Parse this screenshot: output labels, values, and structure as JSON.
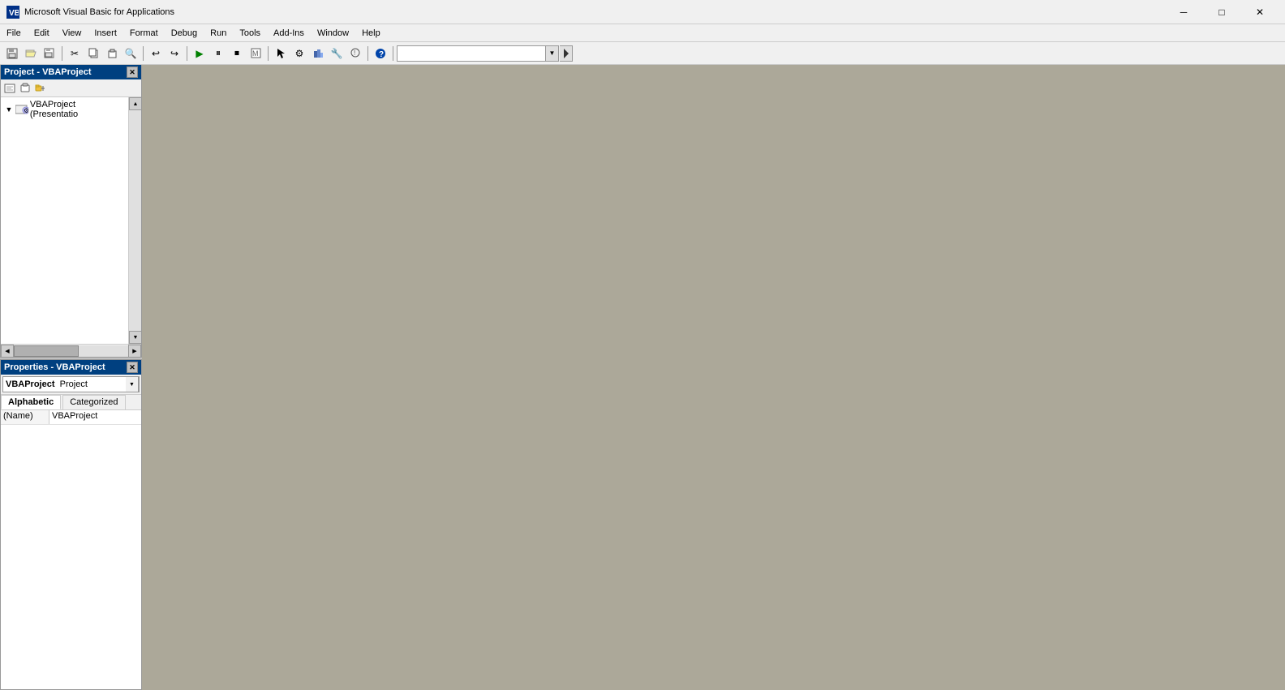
{
  "window": {
    "title": "Microsoft Visual Basic for Applications",
    "icon_label": "VB"
  },
  "title_controls": {
    "minimize": "─",
    "maximize": "□",
    "close": "✕"
  },
  "menu": {
    "items": [
      "File",
      "Edit",
      "View",
      "Insert",
      "Format",
      "Debug",
      "Run",
      "Tools",
      "Add-Ins",
      "Window",
      "Help"
    ]
  },
  "toolbar": {
    "buttons": [
      "💾",
      "📂",
      "💿",
      "✂",
      "📋",
      "📄",
      "↩",
      "↪",
      "▶",
      "⏸",
      "⏹",
      "🔲",
      "🖊",
      "⚙",
      "📊",
      "🔧",
      "❓"
    ]
  },
  "project_panel": {
    "title": "Project - VBAProject",
    "buttons": [
      "📋",
      "📂",
      "🗂"
    ],
    "tree_items": [
      {
        "label": "VBAProject (Presentatio",
        "icon": "⚙",
        "toggle": "▼",
        "indent": 0
      }
    ]
  },
  "properties_panel": {
    "title": "Properties - VBAProject",
    "dropdown_value": "VBAProject  Project",
    "tabs": [
      {
        "label": "Alphabetic",
        "active": true
      },
      {
        "label": "Categorized",
        "active": false
      }
    ],
    "rows": [
      {
        "name": "(Name)",
        "value": "VBAProject"
      }
    ]
  }
}
